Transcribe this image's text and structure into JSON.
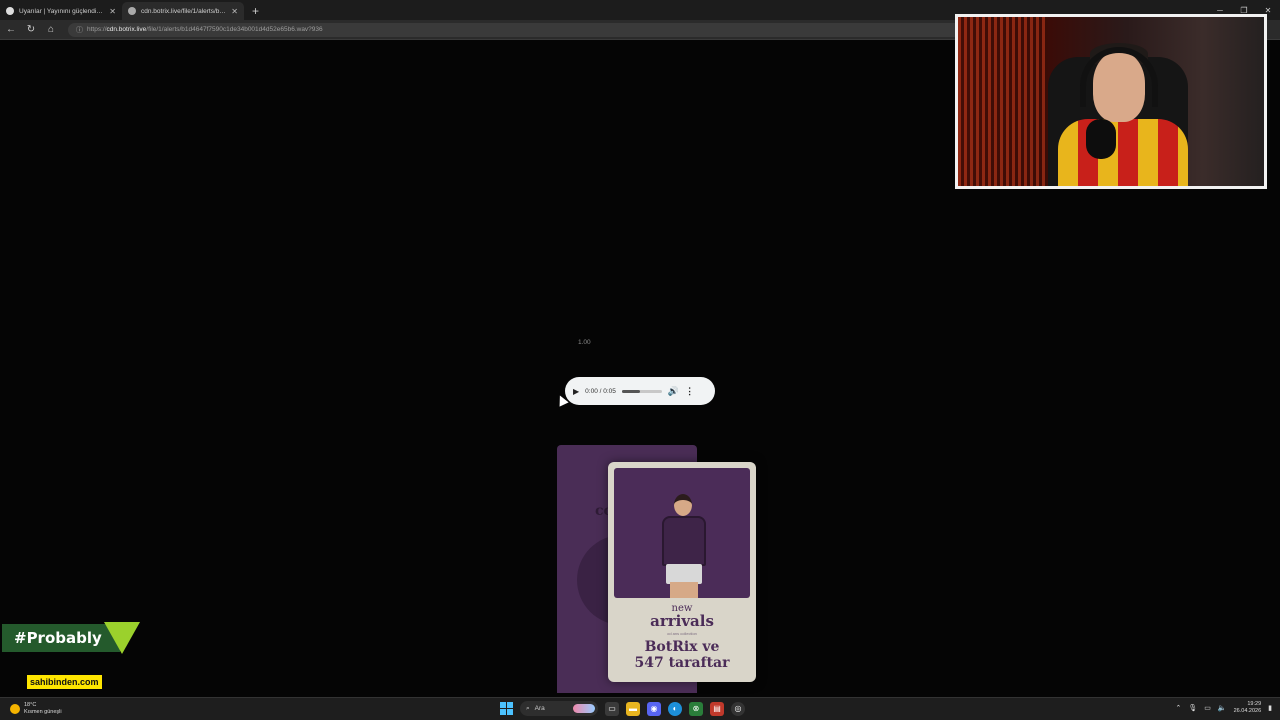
{
  "browser": {
    "tabs": [
      {
        "title": "Uyarılar | Yayınını güçlendirmek için",
        "active": false
      },
      {
        "title": "cdn.botrix.live/file/1/alerts/b1d4647f",
        "active": true
      }
    ],
    "new_tab_icon": "plus-icon",
    "url_prefix": "https://",
    "url_domain": "cdn.botrix.live",
    "url_path": "/file/1/alerts/b1d4647f7590c1de34b001d4d52e65b6.wav?936"
  },
  "media": {
    "playback_speed": "1.00",
    "current_time": "0:00",
    "duration": "0:05",
    "time_display": "0:00 / 0:05",
    "volume_level": 0.45
  },
  "alert_card": {
    "pack_text": "co",
    "badge_line1": "new",
    "badge_line2": "arrivals",
    "badge_sub": "od ans collection",
    "message_line1": "BotRix ve",
    "message_line2": "547 taraftar"
  },
  "overlay": {
    "hashtag": "#Probably",
    "sponsor": "sahibinden.com"
  },
  "taskbar": {
    "temperature": "18°C",
    "weather_desc": "Kısmen güneşli",
    "search_label": "Ara",
    "time": "19:29",
    "date": "26.04.2026"
  }
}
